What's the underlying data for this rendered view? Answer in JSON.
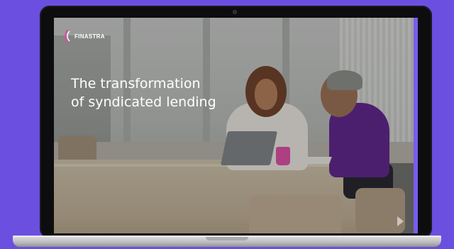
{
  "brand": {
    "name": "FINASTRA"
  },
  "hero": {
    "headline_line1": "The transformation",
    "headline_line2": "of syndicated lending"
  },
  "controls": {
    "play_icon": "play-icon"
  },
  "colors": {
    "background": "#6b4fe0",
    "accent": "#7a5cf0",
    "mug": "#e04aa5",
    "person2_top": "#5b1d8a"
  }
}
